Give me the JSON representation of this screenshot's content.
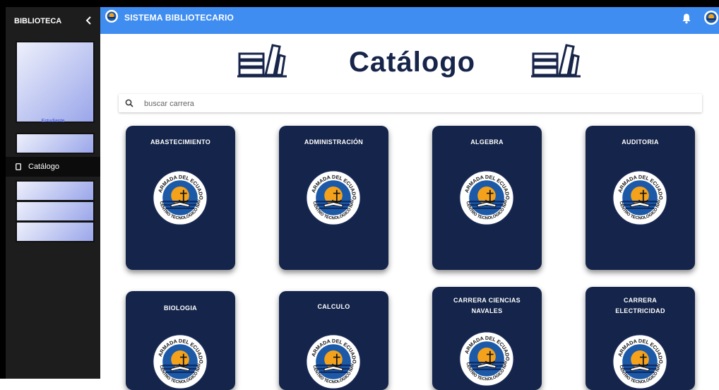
{
  "sidebar": {
    "title": "BIBLIOTECA",
    "student_label": "Estudiante",
    "active_item": "Catálogo"
  },
  "topbar": {
    "title": "SISTEMA BIBLIOTECARIO"
  },
  "page": {
    "heading": "Catálogo"
  },
  "search": {
    "placeholder": "buscar carrera"
  },
  "cards": [
    {
      "line1": "ABASTECIMIENTO",
      "line2": ""
    },
    {
      "line1": "ADMINISTRACIÓN",
      "line2": ""
    },
    {
      "line1": "ALGEBRA",
      "line2": ""
    },
    {
      "line1": "AUDITORIA",
      "line2": ""
    },
    {
      "line1": "BIOLOGIA",
      "line2": ""
    },
    {
      "line1": "CALCULO",
      "line2": ""
    },
    {
      "line1": "CARRERA CIENCIAS",
      "line2": "NAVALES"
    },
    {
      "line1": "CARRERA",
      "line2": "ELECTRICIDAD"
    }
  ],
  "logo": {
    "top_text": "ARMADA DEL ECUADOR",
    "bottom_text": "CENTRO TECNOLÓGICO NAVAL"
  },
  "colors": {
    "topbar": "#3f8df0",
    "sidebar": "#1d1d1d",
    "card": "#14244a",
    "heading": "#17254a"
  },
  "icons": [
    "chevron-left-icon",
    "catalog-icon",
    "bell-icon",
    "avatar-logo",
    "books-icon",
    "search-icon",
    "naval-logo"
  ]
}
